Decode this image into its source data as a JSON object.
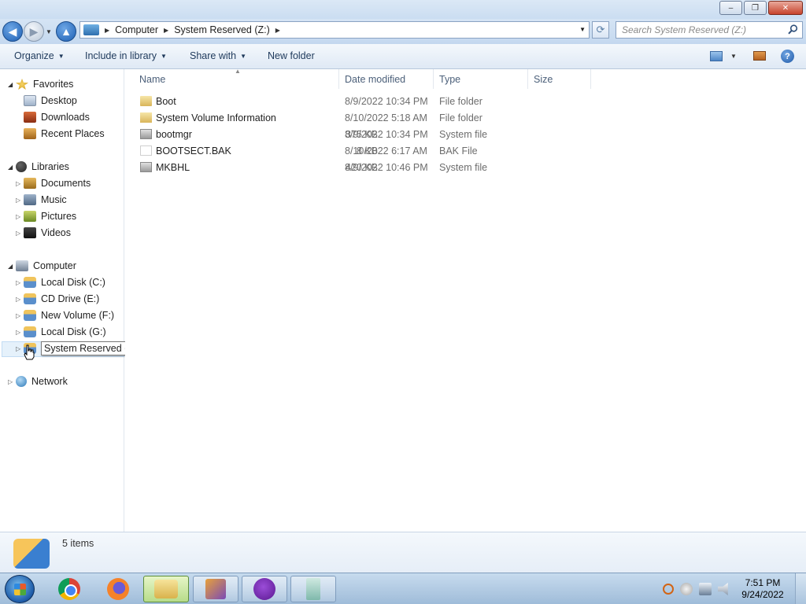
{
  "window": {
    "minimize_label": "‒",
    "maximize_label": "❐",
    "close_label": "✕"
  },
  "address": {
    "crumbs": [
      "Computer",
      "System Reserved (Z:)"
    ],
    "search_placeholder": "Search System Reserved (Z:)"
  },
  "toolbar": {
    "organize": "Organize",
    "include_in_library": "Include in library",
    "share_with": "Share with",
    "new_folder": "New folder"
  },
  "sidebar": {
    "favorites": {
      "label": "Favorites",
      "items": [
        "Desktop",
        "Downloads",
        "Recent Places"
      ]
    },
    "libraries": {
      "label": "Libraries",
      "items": [
        "Documents",
        "Music",
        "Pictures",
        "Videos"
      ]
    },
    "computer": {
      "label": "Computer",
      "items": [
        "Local Disk (C:)",
        "CD Drive (E:)",
        "New Volume (F:)",
        "Local Disk (G:)",
        "System Reserved (Z:)"
      ]
    },
    "network": {
      "label": "Network"
    }
  },
  "columns": {
    "name": "Name",
    "date_modified": "Date modified",
    "type": "Type",
    "size": "Size"
  },
  "files": [
    {
      "name": "Boot",
      "date": "8/9/2022 10:34 PM",
      "type": "File folder",
      "size": "",
      "icon": "folder-icon"
    },
    {
      "name": "System Volume Information",
      "date": "8/10/2022 5:18 AM",
      "type": "File folder",
      "size": "",
      "icon": "locked-folder-icon"
    },
    {
      "name": "bootmgr",
      "date": "8/9/2022 10:34 PM",
      "type": "System file",
      "size": "375 KB",
      "icon": "system-file-icon"
    },
    {
      "name": "BOOTSECT.BAK",
      "date": "8/10/2022 6:17 AM",
      "type": "BAK File",
      "size": "8 KB",
      "icon": "bak-file-icon"
    },
    {
      "name": "MKBHL",
      "date": "8/9/2022 10:46 PM",
      "type": "System file",
      "size": "420 KB",
      "icon": "system-file-icon"
    }
  ],
  "details": {
    "item_count": "5 items"
  },
  "taskbar": {
    "time": "7:51 PM",
    "date": "9/24/2022"
  }
}
